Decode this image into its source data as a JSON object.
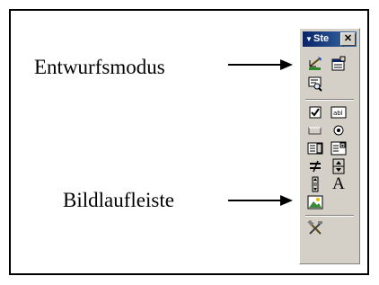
{
  "callouts": {
    "design_mode": "Entwurfsmodus",
    "scrollbar": "Bildlaufleiste"
  },
  "toolbar": {
    "title": "Ste",
    "close_glyph": "✕",
    "dropdown_glyph": "▼",
    "label_glyph": "A",
    "buttons": [
      "design-mode",
      "properties",
      "view-code",
      "checkbox",
      "text-box",
      "command-button",
      "option-button",
      "list-box",
      "combo-box",
      "toggle-button",
      "spin-button",
      "scroll-bar",
      "label",
      "image",
      "more-controls"
    ]
  }
}
